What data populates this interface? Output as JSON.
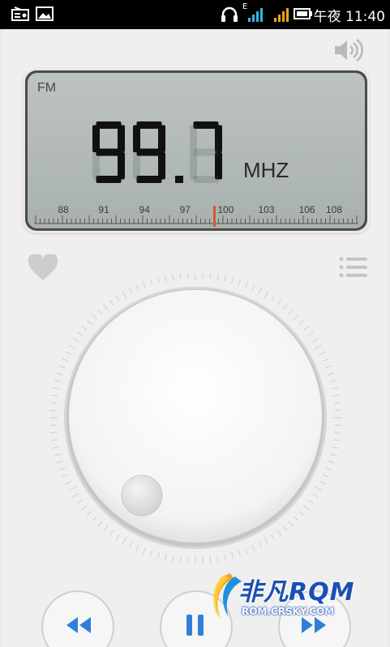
{
  "status_bar": {
    "time": "午夜 11:40",
    "network_label": "E"
  },
  "display": {
    "band": "FM",
    "frequency": "99.7",
    "unit": "MHZ",
    "scale_labels": [
      "88",
      "91",
      "94",
      "97",
      "100",
      "103",
      "106",
      "108"
    ]
  },
  "watermark": {
    "brand": "非凡RQM",
    "site": "ROM.CRSKY.COM"
  },
  "colors": {
    "lcd_background": "#b3bbb8",
    "needle": "#d9572c",
    "control_icon": "#2f7fd8"
  }
}
